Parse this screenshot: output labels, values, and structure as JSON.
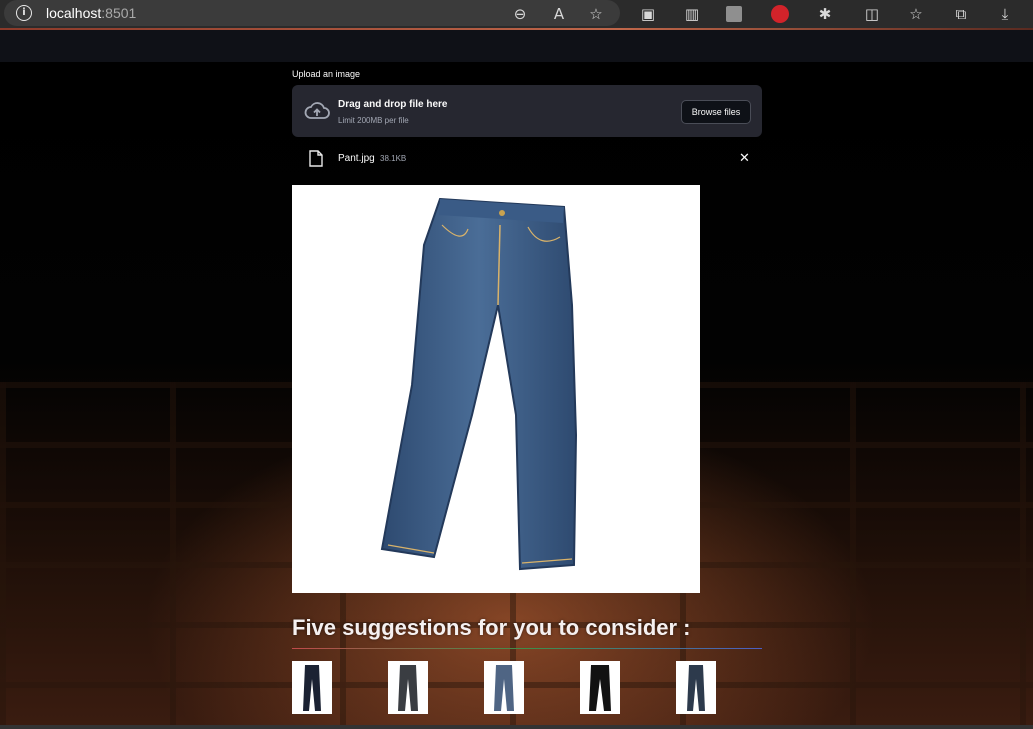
{
  "browser": {
    "host": "localhost",
    "port": ":8501",
    "icons": [
      "info-icon",
      "zoom-out-icon",
      "read-aloud-icon",
      "favorite-star-icon",
      "tab-icon",
      "reading-view-icon",
      "extension-icon",
      "adblock-icon",
      "puzzle-icon",
      "split-screen-icon",
      "favorites-icon",
      "collections-icon",
      "download-icon"
    ]
  },
  "uploader": {
    "label": "Upload an image",
    "drop_title": "Drag and drop file here",
    "drop_limit": "Limit 200MB per file",
    "browse_label": "Browse files"
  },
  "file": {
    "name": "Pant.jpg",
    "size": "38.1KB"
  },
  "suggestions": {
    "title": "Five suggestions for you to consider :",
    "items": [
      {
        "color": "#1b2233"
      },
      {
        "color": "#3a3d42"
      },
      {
        "color": "#4f6584"
      },
      {
        "color": "#121212"
      },
      {
        "color": "#2d3a4c"
      }
    ]
  },
  "colors": {
    "denim": "#37577e",
    "denim_dark": "#27405f",
    "stitch": "#d8b26a"
  }
}
